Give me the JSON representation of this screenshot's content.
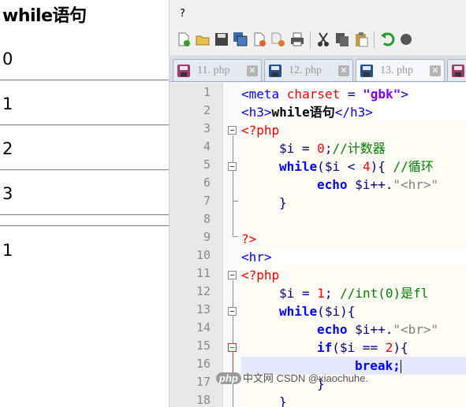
{
  "browser": {
    "heading": "while语句",
    "loop1_output": [
      "0",
      "1",
      "2",
      "3"
    ],
    "loop2_output": [
      "1"
    ]
  },
  "editor": {
    "menu_label": "?",
    "tabs": [
      {
        "label": "11. php",
        "active": false
      },
      {
        "label": "12. php",
        "active": false
      },
      {
        "label": "13. php",
        "active": true
      }
    ],
    "line_numbers": [
      "1",
      "2",
      "3",
      "4",
      "5",
      "6",
      "7",
      "8",
      "9",
      "10",
      "11",
      "12",
      "13",
      "14",
      "15",
      "16",
      "17",
      "18"
    ],
    "code": {
      "l1": {
        "t1": "<meta ",
        "t2": "charset",
        "t3": " = ",
        "t4": "\"gbk\"",
        "t5": ">"
      },
      "l2": {
        "t1": "<h3>",
        "t2": "while语句",
        "t3": "</h3>"
      },
      "l3": {
        "t1": "<?php"
      },
      "l4": {
        "t1": "$i",
        "t2": " = ",
        "t3": "0",
        "t4": ";",
        "t5": "//计数器"
      },
      "l5": {
        "t1": "while",
        "t2": "(",
        "t3": "$i",
        "t4": " < ",
        "t5": "4",
        "t6": "){ ",
        "t7": "//循环"
      },
      "l6": {
        "t1": "echo",
        "t2": " ",
        "t3": "$i",
        "t4": "++.",
        "t5": "\"<hr>\""
      },
      "l7": {
        "t1": "}"
      },
      "l9": {
        "t1": "?>"
      },
      "l10": {
        "t1": "<hr>"
      },
      "l11": {
        "t1": "<?php"
      },
      "l12": {
        "t1": "$i",
        "t2": " = ",
        "t3": "1",
        "t4": "; ",
        "t5": "//int(0)是fl"
      },
      "l13": {
        "t1": "while",
        "t2": "(",
        "t3": "$i",
        "t4": "){"
      },
      "l14": {
        "t1": "echo",
        "t2": " ",
        "t3": "$i",
        "t4": "++.",
        "t5": "\"<br>\""
      },
      "l15": {
        "t1": "if",
        "t2": "(",
        "t3": "$i",
        "t4": " == ",
        "t5": "2",
        "t6": "){"
      },
      "l16": {
        "t1": "break;"
      },
      "l17": {
        "t1": "}"
      },
      "l18": {
        "t1": "}"
      }
    }
  },
  "watermark": {
    "logo": "php",
    "text": "中文网",
    "csdn": "CSDN @xiaochuhe."
  }
}
